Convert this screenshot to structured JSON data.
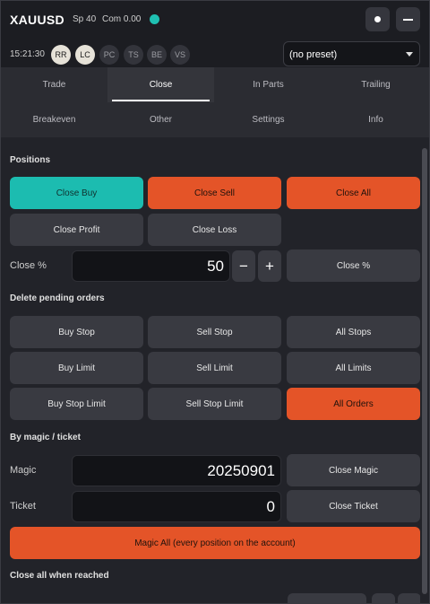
{
  "header": {
    "symbol": "XAUUSD",
    "spread": "Sp 40",
    "commission": "Com 0.00",
    "status_color": "#1fc0b2"
  },
  "toolbar": {
    "time": "15:21:30",
    "chips": [
      {
        "label": "RR",
        "active": true
      },
      {
        "label": "LC",
        "active": true
      },
      {
        "label": "PC",
        "active": false
      },
      {
        "label": "TS",
        "active": false
      },
      {
        "label": "BE",
        "active": false
      },
      {
        "label": "VS",
        "active": false
      }
    ],
    "preset_value": "(no preset)"
  },
  "tabs": {
    "row1": [
      "Trade",
      "Close",
      "In Parts",
      "Trailing"
    ],
    "row2": [
      "Breakeven",
      "Other",
      "Settings",
      "Info"
    ],
    "active": "Close"
  },
  "positions": {
    "title": "Positions",
    "close_buy": "Close Buy",
    "close_sell": "Close Sell",
    "close_all": "Close All",
    "close_profit": "Close Profit",
    "close_loss": "Close Loss",
    "close_pct_label": "Close %",
    "close_pct_value": "50",
    "minus": "−",
    "plus": "+",
    "close_pct_button": "Close %"
  },
  "pending": {
    "title": "Delete pending orders",
    "buy_stop": "Buy Stop",
    "sell_stop": "Sell Stop",
    "all_stops": "All Stops",
    "buy_limit": "Buy Limit",
    "sell_limit": "Sell Limit",
    "all_limits": "All Limits",
    "buy_stop_limit": "Buy Stop Limit",
    "sell_stop_limit": "Sell Stop Limit",
    "all_orders": "All Orders"
  },
  "magic": {
    "title": "By magic / ticket",
    "magic_label": "Magic",
    "magic_value": "20250901",
    "close_magic": "Close Magic",
    "ticket_label": "Ticket",
    "ticket_value": "0",
    "close_ticket": "Close Ticket",
    "magic_all": "Magic All (every position on the account)"
  },
  "reached": {
    "title": "Close all when reached"
  },
  "colors": {
    "accent_teal": "#1cbcb0",
    "accent_orange": "#e45428",
    "background": "#222329"
  }
}
